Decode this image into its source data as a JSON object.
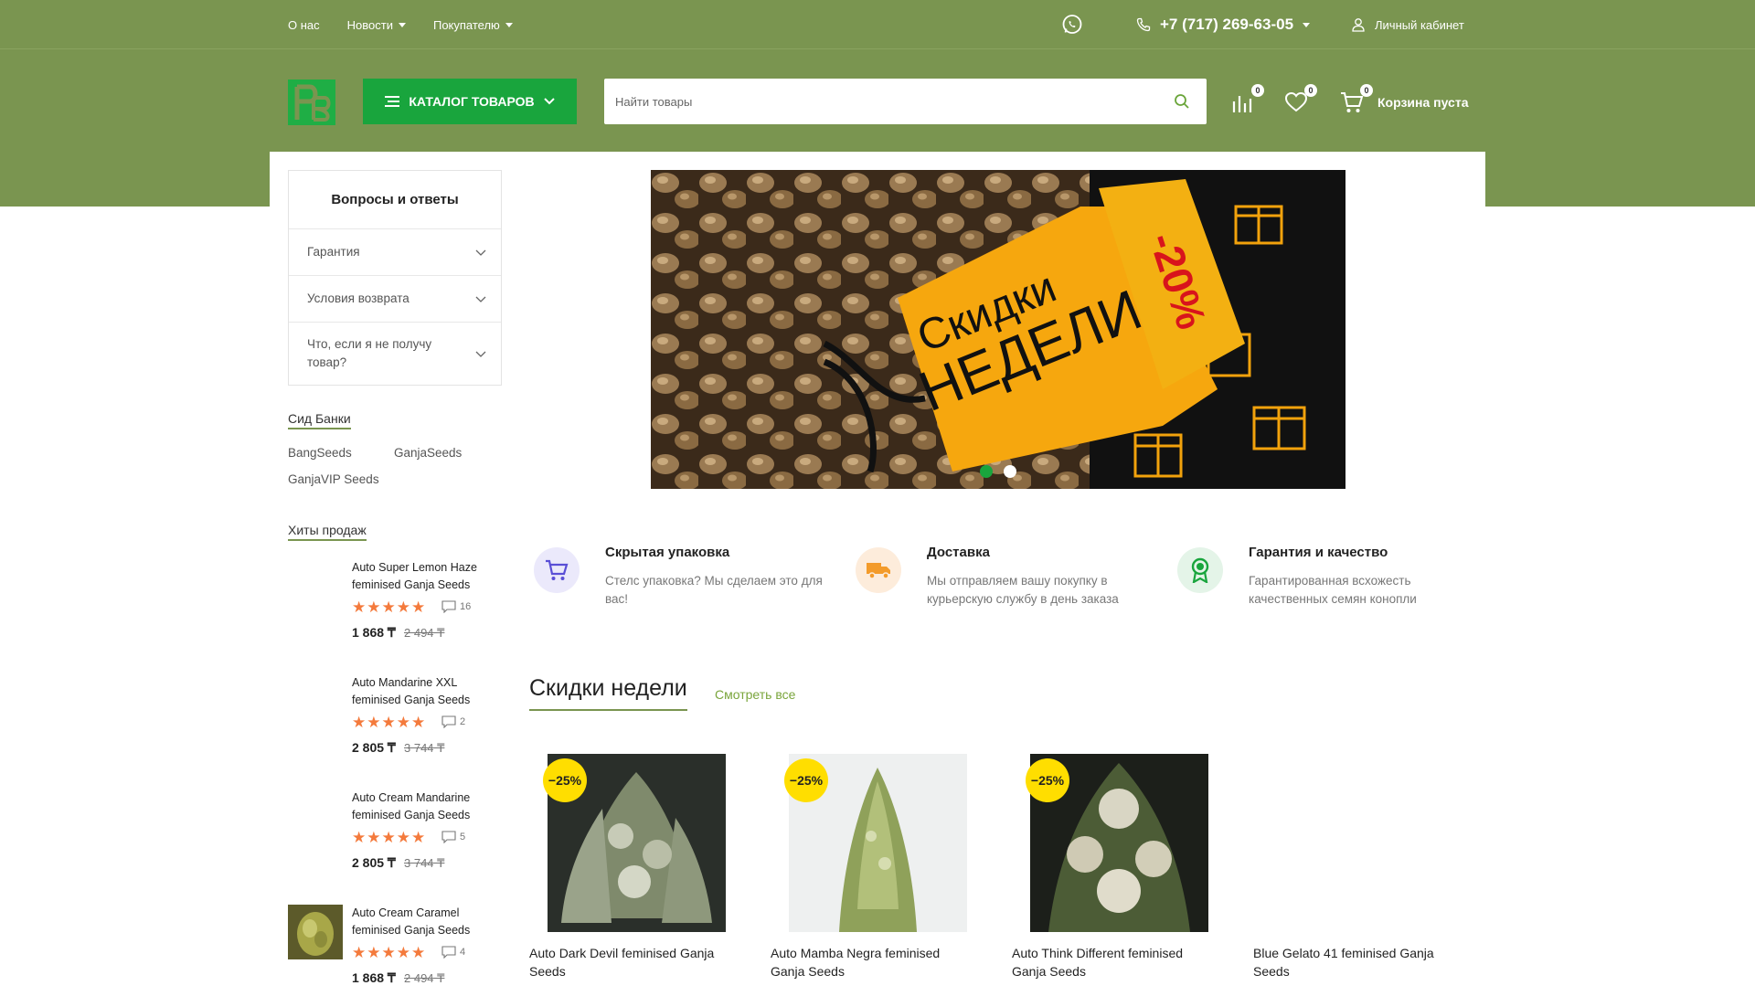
{
  "topbar": {
    "nav": [
      {
        "label": "О нас",
        "has_caret": false
      },
      {
        "label": "Новости",
        "has_caret": true
      },
      {
        "label": "Покупателю",
        "has_caret": true
      }
    ],
    "phone": "+7 (717) 269-63-05",
    "account": "Личный кабинет"
  },
  "header": {
    "catalog_label": "КАТАЛОГ ТОВАРОВ",
    "search_placeholder": "Найти товары",
    "compare_count": "0",
    "wishlist_count": "0",
    "cart_count": "0",
    "cart_label": "Корзина пуста"
  },
  "colors": {
    "brand_green": "#7a9550",
    "catalog_green": "#19a53d",
    "star_orange": "#f47a3c",
    "sale_yellow": "#ffde00"
  },
  "faq": {
    "title": "Вопросы и ответы",
    "items": [
      "Гарантия",
      "Условия возврата",
      "Что, если я не получу товар?"
    ]
  },
  "seed_banks": {
    "title": "Сид Банки",
    "items": [
      "BangSeeds",
      "GanjaSeeds",
      "GanjaVIP Seeds"
    ]
  },
  "bestsellers": {
    "title": "Хиты продаж",
    "items": [
      {
        "name": "Auto Super Lemon Haze feminised Ganja Seeds",
        "rating": 5,
        "reviews": "16",
        "price": "1 868 ₸",
        "old_price": "2 494 ₸"
      },
      {
        "name": "Auto Mandarine XXL feminised Ganja Seeds",
        "rating": 5,
        "reviews": "2",
        "price": "2 805 ₸",
        "old_price": "3 744 ₸"
      },
      {
        "name": "Auto Cream Mandarine feminised Ganja Seeds",
        "rating": 5,
        "reviews": "5",
        "price": "2 805 ₸",
        "old_price": "3 744 ₸"
      },
      {
        "name": "Auto Cream Caramel feminised Ganja Seeds",
        "rating": 5,
        "reviews": "4",
        "price": "1 868 ₸",
        "old_price": "2 494 ₸"
      }
    ]
  },
  "banner": {
    "line1": "Скидки",
    "line2": "НЕДЕЛИ",
    "discount": "-20%",
    "active_slide": 1,
    "slides": 2
  },
  "features": [
    {
      "title": "Скрытая упаковка",
      "text": "Стелс упаковка? Мы сделаем это для вас!",
      "icon": "cart-icon"
    },
    {
      "title": "Доставка",
      "text": "Мы отправляем вашу покупку в курьерскую службу в день заказа",
      "icon": "truck-icon"
    },
    {
      "title": "Гарантия и качество",
      "text": "Гарантированная всхожесть качественных семян конопли",
      "icon": "award-icon"
    }
  ],
  "discounts": {
    "title": "Скидки недели",
    "see_all": "Смотреть все",
    "products": [
      {
        "name": "Auto Dark Devil feminised Ganja Seeds",
        "sale": "−25%"
      },
      {
        "name": "Auto Mamba Negra feminised Ganja Seeds",
        "sale": "−25%"
      },
      {
        "name": "Auto Think Different feminised Ganja Seeds",
        "sale": "−25%"
      },
      {
        "name": "Blue Gelato 41 feminised Ganja Seeds",
        "sale": ""
      }
    ]
  }
}
